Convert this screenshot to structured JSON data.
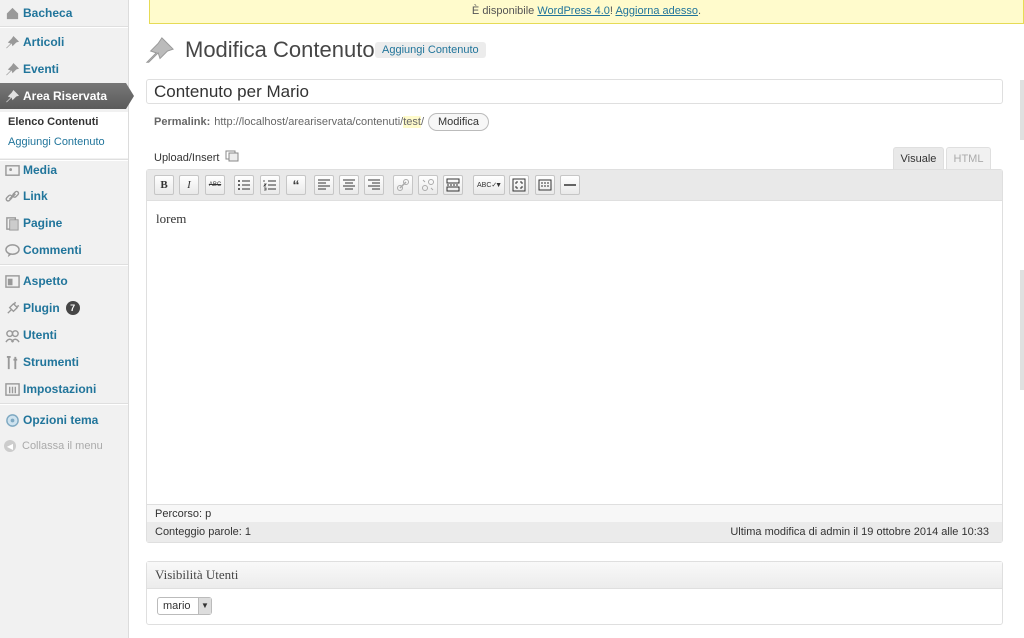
{
  "sidebar": {
    "items": [
      {
        "label": "Bacheca",
        "icon": "dashboard-icon"
      },
      {
        "label": "Articoli",
        "icon": "pin-icon"
      },
      {
        "label": "Eventi",
        "icon": "pin-icon"
      },
      {
        "label": "Area Riservata",
        "icon": "pin-icon"
      },
      {
        "label": "Media",
        "icon": "media-icon"
      },
      {
        "label": "Link",
        "icon": "link-icon"
      },
      {
        "label": "Pagine",
        "icon": "pages-icon"
      },
      {
        "label": "Commenti",
        "icon": "comments-icon"
      },
      {
        "label": "Aspetto",
        "icon": "appearance-icon"
      },
      {
        "label": "Plugin",
        "icon": "plugin-icon",
        "badge": "7"
      },
      {
        "label": "Utenti",
        "icon": "users-icon"
      },
      {
        "label": "Strumenti",
        "icon": "tools-icon"
      },
      {
        "label": "Impostazioni",
        "icon": "settings-icon"
      },
      {
        "label": "Opzioni tema",
        "icon": "theme-options-icon"
      }
    ],
    "submenu": [
      "Elenco Contenuti",
      "Aggiungi Contenuto"
    ],
    "collapse_label": "Collassa il menu"
  },
  "notice": {
    "prefix": "È disponibile ",
    "link1": "WordPress 4.0",
    "sep": "! ",
    "link2": "Aggiorna adesso",
    "suffix": "."
  },
  "header": {
    "title": "Modifica Contenuto",
    "add_new": "Aggiungi Contenuto"
  },
  "post": {
    "title": "Contenuto per Mario",
    "permalink_label": "Permalink:",
    "permalink_base": "http://localhost/areariservata/contenuti/",
    "permalink_slug": "test",
    "permalink_end": "/",
    "edit_slug": "Modifica"
  },
  "editor": {
    "upload_label": "Upload/Insert",
    "tab_visual": "Visuale",
    "tab_html": "HTML",
    "content": "lorem",
    "path_label": "Percorso: p",
    "word_count": "Conteggio parole: 1",
    "last_edit": "Ultima modifica di admin il 19 ottobre 2014 alle 10:33",
    "toolbar": [
      "B",
      "I",
      "ABC",
      "bullet-list",
      "numbered-list",
      "blockquote",
      "align-left",
      "align-center",
      "align-right",
      "link",
      "unlink",
      "more",
      "spellcheck",
      "fullscreen",
      "kitchen-sink",
      "hr"
    ]
  },
  "visibility": {
    "title": "Visibilità Utenti",
    "selected": "mario"
  }
}
